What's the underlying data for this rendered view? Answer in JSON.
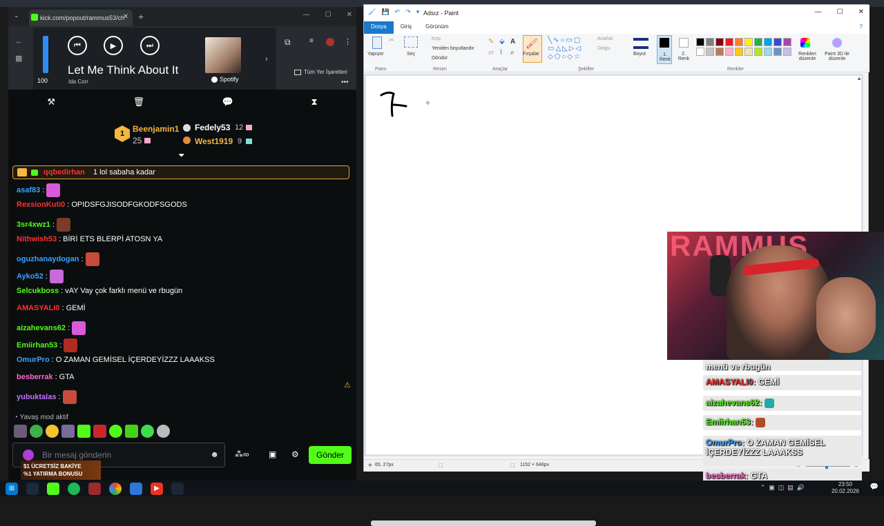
{
  "browser": {
    "tab_title": "kick.com/popout/rammus53/ch",
    "bookmarks_label": "Tüm Yer İşaretleri"
  },
  "spotify": {
    "volume": "100",
    "volume_fraction": 1.0,
    "song": "Let Me Think About It",
    "artist": "Ida Corr",
    "brand": "Spotify"
  },
  "leaderboard": {
    "first": {
      "rank": "1",
      "name": "Beenjamin1",
      "count": "25"
    },
    "second": {
      "name": "Fedely53",
      "count": "12"
    },
    "third": {
      "name": "West1919",
      "count": "9"
    }
  },
  "chat": {
    "pinned": {
      "user": "qqbedirhan",
      "text": "1 lol sabaha kadar"
    },
    "messages": [
      {
        "user": "asaf83",
        "color": "#3aa0ff",
        "text": ""
      },
      {
        "user": "RexsionKuti0",
        "color": "#ff3030",
        "text": "OPIDSFGJISODFGKODFSGODS"
      },
      {
        "user": "3sr4xwz1",
        "color": "#53fc18",
        "text": ""
      },
      {
        "user": "Nithwish53",
        "color": "#ff3030",
        "text": "BİRİ ETS BLERPİ ATOSN YA"
      },
      {
        "user": "oguzhanaydogan",
        "color": "#3aa0ff",
        "text": ""
      },
      {
        "user": "Ayko52",
        "color": "#3aa0ff",
        "text": ""
      },
      {
        "user": "Selcukboss",
        "color": "#53fc18",
        "text": "vAY Vay çok farklı menü ve rbugün"
      },
      {
        "user": "AMASYALI0",
        "color": "#ff3030",
        "text": "GEMİ"
      },
      {
        "user": "aizahevans62",
        "color": "#53fc18",
        "text": ""
      },
      {
        "user": "Emiirhan53",
        "color": "#53fc18",
        "text": ""
      },
      {
        "user": "OmurPro",
        "color": "#3aa0ff",
        "text": "O ZAMAN GEMİSEL İÇERDEYİZZZ LAAAKSS"
      },
      {
        "user": "besberrak",
        "color": "#ff66cc",
        "text": "GTA"
      },
      {
        "user": "yubuktalas",
        "color": "#c070ff",
        "text": ""
      }
    ],
    "slow_mode": "Yavaş mod aktif",
    "input_placeholder": "Bir mesaj gönderin",
    "send_label": "Gönder"
  },
  "ad": {
    "line1": "$1 ÜCRETSİZ BAKİYE",
    "line2": "%1 YATIRMA BONUSU"
  },
  "paint": {
    "title": "Adsız - Paint",
    "tabs": [
      "Dosya",
      "Giriş",
      "Görünüm"
    ],
    "groups": {
      "pano": "Pano",
      "resim": "Resim",
      "araclar": "Araçlar",
      "sekiller": "Şekiller",
      "renkler": "Renkler"
    },
    "buttons": {
      "paste": "Yapıştır",
      "select": "Seç",
      "crop": "Kırp",
      "resize": "Yeniden boyutlandır",
      "rotate": "Döndür",
      "brushes": "Fırçalar",
      "outline": "Anahat",
      "fill": "Dolgu",
      "size": "Boyut",
      "color1": "1. Renk",
      "color2": "2. Renk",
      "edit_colors": "Renkleri düzenle",
      "paint3d": "Paint 3D ile düzenle"
    },
    "palette": [
      "#000000",
      "#7f7f7f",
      "#880015",
      "#ed1c24",
      "#ff7f27",
      "#fff200",
      "#22b14c",
      "#00a2e8",
      "#3f48cc",
      "#a349a4",
      "#ffffff",
      "#c3c3c3",
      "#b97a57",
      "#ffaec9",
      "#ffc90e",
      "#efe4b0",
      "#b5e61d",
      "#99d9ea",
      "#7092be",
      "#c8bfe7"
    ],
    "status": {
      "cursor": "65, 27px",
      "canvas_size": "1152 × 648px",
      "zoom": "%200"
    }
  },
  "overlay_chat": [
    {
      "user": "",
      "text": "menü ve rbugün"
    },
    {
      "user": "AMASYALI0",
      "text": "GEMİ"
    },
    {
      "user": "aizahevans62",
      "text": ""
    },
    {
      "user": "Emiirhan53",
      "text": ""
    },
    {
      "user": "OmurPro",
      "text": "O ZAMAN GEMİSEL İÇERDEYİZZZ LAAAKSS"
    },
    {
      "user": "besberrak",
      "text": "GTA"
    }
  ],
  "taskbar": {
    "time": "23:50",
    "date": "20.02.2026"
  }
}
